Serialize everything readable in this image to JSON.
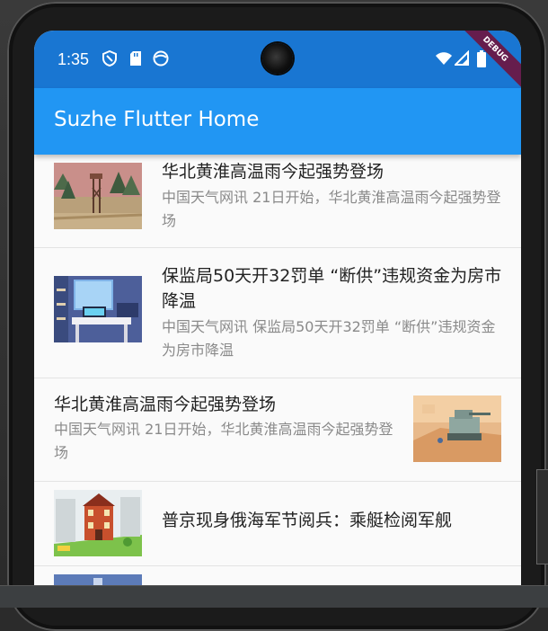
{
  "status_bar": {
    "time": "1:35",
    "debug_banner": "DEBUG",
    "icons": [
      "shield-icon",
      "sd-card-icon",
      "face-icon",
      "wifi-icon",
      "signal-icon",
      "battery-icon"
    ]
  },
  "app_bar": {
    "title": "Suzhe Flutter Home"
  },
  "colors": {
    "status_bar": "#1976d2",
    "app_bar": "#2196f3",
    "background": "#fafafa"
  },
  "news": [
    {
      "title": "华北黄淮高温雨今起强势登场",
      "summary": "中国天气网讯 21日开始，华北黄淮高温雨今起强势登场",
      "layout": "image-left"
    },
    {
      "title": "保监局50天开32罚单 “断供”违规资金为房市降温",
      "summary": "中国天气网讯 保监局50天开32罚单 “断供”违规资金为房市降温",
      "layout": "image-left"
    },
    {
      "title": "华北黄淮高温雨今起强势登场",
      "summary": "中国天气网讯 21日开始，华北黄淮高温雨今起强势登场",
      "layout": "image-right"
    },
    {
      "title": "普京现身俄海军节阅兵：乘艇检阅军舰",
      "summary": "",
      "layout": "image-left"
    }
  ]
}
